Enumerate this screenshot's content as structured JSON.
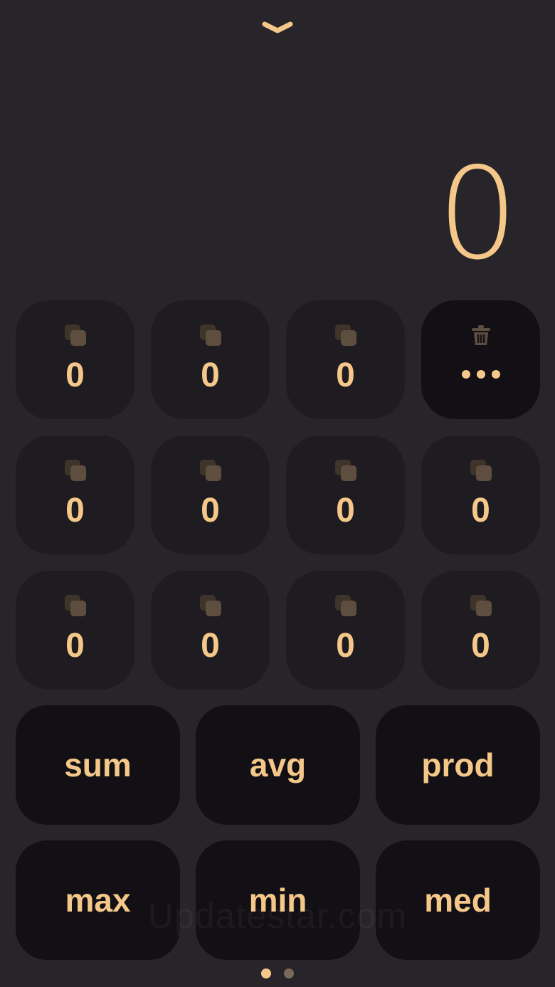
{
  "collapse_icon": "chevron-down-icon",
  "display": {
    "value": "0"
  },
  "memory_slots": [
    {
      "value": "0",
      "icon": "copy-icon"
    },
    {
      "value": "0",
      "icon": "copy-icon"
    },
    {
      "value": "0",
      "icon": "copy-icon"
    },
    {
      "value": "0",
      "icon": "copy-icon"
    },
    {
      "value": "0",
      "icon": "copy-icon"
    },
    {
      "value": "0",
      "icon": "copy-icon"
    },
    {
      "value": "0",
      "icon": "copy-icon"
    },
    {
      "value": "0",
      "icon": "copy-icon"
    },
    {
      "value": "0",
      "icon": "copy-icon"
    },
    {
      "value": "0",
      "icon": "copy-icon"
    },
    {
      "value": "0",
      "icon": "copy-icon"
    }
  ],
  "clear_tile": {
    "icon": "trash-icon",
    "more_icon": "more-dots-icon"
  },
  "operations": [
    {
      "label": "sum"
    },
    {
      "label": "avg"
    },
    {
      "label": "prod"
    },
    {
      "label": "max"
    },
    {
      "label": "min"
    },
    {
      "label": "med"
    }
  ],
  "watermark": "Updatestar.com",
  "pager": {
    "pages": 2,
    "current": 1
  },
  "colors": {
    "background": "#27252a",
    "tile": "#1e1c20",
    "tile_dark": "#121014",
    "accent": "#f5c88a",
    "icon_muted": "#5e4e3f"
  }
}
